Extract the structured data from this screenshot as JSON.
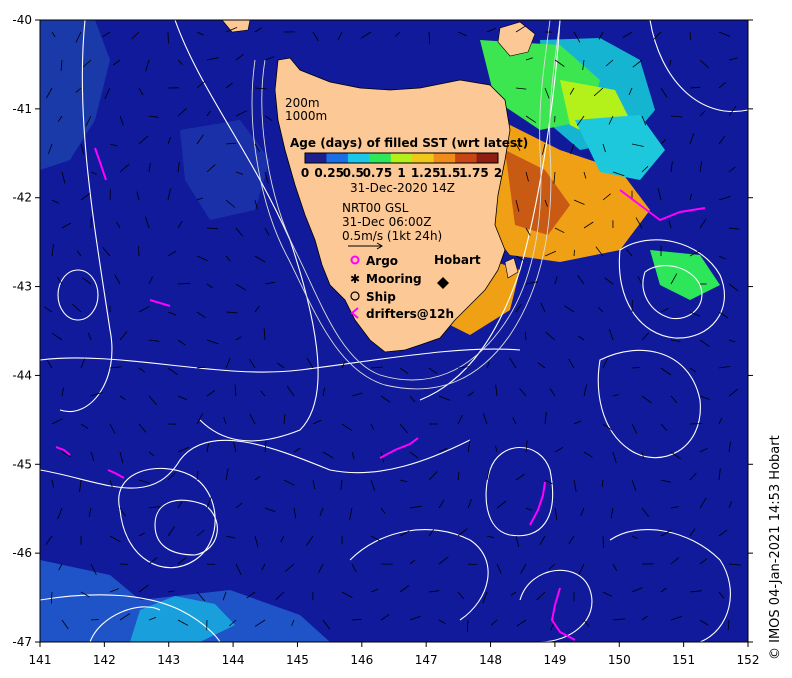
{
  "map": {
    "lon_ticks": [
      "141",
      "142",
      "143",
      "144",
      "145",
      "146",
      "147",
      "148",
      "149",
      "150",
      "151",
      "152"
    ],
    "lat_ticks": [
      "-40",
      "-41",
      "-42",
      "-43",
      "-44",
      "-45",
      "-46",
      "-47"
    ],
    "lon_range": [
      141,
      152
    ],
    "lat_range": [
      -47,
      -40
    ],
    "colors": {
      "ocean": "#101a9a",
      "land": "#fbc896",
      "contour": "#ffffff",
      "argo": "#ff00ff",
      "frame": "#000000"
    }
  },
  "legend": {
    "isobath_shallow": "200m",
    "isobath_deep": "1000m",
    "colorbar_title": "Age (days) of filled SST (wrt latest)",
    "colorbar_ticks": [
      "0",
      "0.25",
      "0.5",
      "0.75",
      "1",
      "1.25",
      "1.5",
      "1.75",
      "2"
    ],
    "colorbar_colors": [
      "#1e1e8c",
      "#1a6ee6",
      "#19c8e6",
      "#2ee65a",
      "#b4f019",
      "#f0c819",
      "#f08c19",
      "#c84614",
      "#8c1e14"
    ],
    "date": "31-Dec-2020 14Z",
    "product": "NRT00 GSL",
    "product_time": "31-Dec 06:00Z",
    "velocity_scale": "0.5m/s (1kt 24h)",
    "symbols": [
      {
        "label": "Argo",
        "icon": "argo-circle-icon"
      },
      {
        "label": "Mooring",
        "icon": "mooring-star-icon"
      },
      {
        "label": "Ship",
        "icon": "ship-circle-icon"
      },
      {
        "label": "drifters@12h",
        "icon": "drifter-arrow-icon"
      }
    ]
  },
  "places": {
    "city": "Hobart"
  },
  "credit": "© IMOS 04-Jan-2021 14:53 Hobart"
}
